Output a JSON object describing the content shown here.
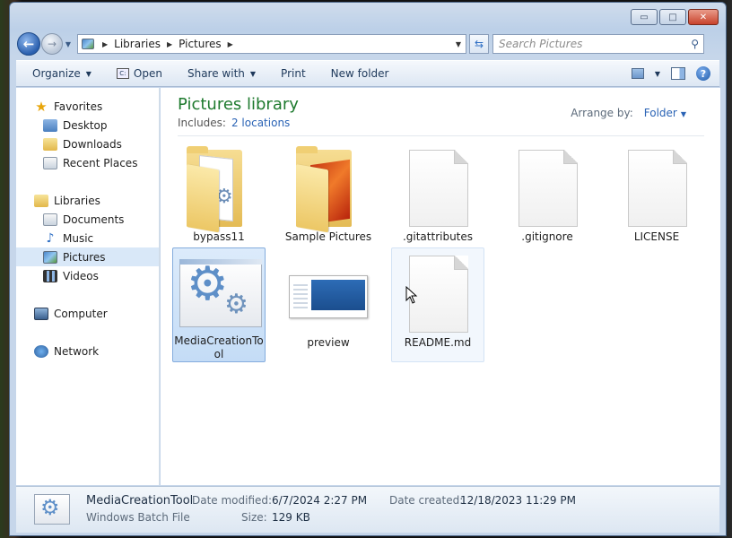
{
  "window": {
    "caption": {
      "minimize": "▭",
      "maximize": "□",
      "close": "✕"
    }
  },
  "nav": {
    "back_glyph": "←",
    "forward_glyph": "→",
    "breadcrumb": [
      "Libraries",
      "Pictures"
    ],
    "search_placeholder": "Search Pictures"
  },
  "toolbar": {
    "organize": "Organize",
    "open": "Open",
    "share_with": "Share with",
    "print": "Print",
    "new_folder": "New folder",
    "help": "?"
  },
  "sidebar": {
    "favorites": {
      "label": "Favorites",
      "items": [
        "Desktop",
        "Downloads",
        "Recent Places"
      ]
    },
    "libraries": {
      "label": "Libraries",
      "items": [
        "Documents",
        "Music",
        "Pictures",
        "Videos"
      ]
    },
    "computer": "Computer",
    "network": "Network",
    "selected": "Pictures"
  },
  "library": {
    "title": "Pictures library",
    "includes_label": "Includes:",
    "includes_link": "2 locations",
    "arrange_label": "Arrange by:",
    "arrange_value": "Folder"
  },
  "files": [
    {
      "name": "bypass11",
      "kind": "folder-docs"
    },
    {
      "name": "Sample Pictures",
      "kind": "folder-photo"
    },
    {
      "name": ".gitattributes",
      "kind": "file"
    },
    {
      "name": ".gitignore",
      "kind": "file"
    },
    {
      "name": "LICENSE",
      "kind": "file"
    },
    {
      "name": "MediaCreationTool",
      "kind": "batch",
      "selected": true
    },
    {
      "name": "preview",
      "kind": "image"
    },
    {
      "name": "README.md",
      "kind": "file",
      "hover": true
    }
  ],
  "details": {
    "name": "MediaCreationTool",
    "type": "Windows Batch File",
    "modified_label": "Date modified:",
    "modified_value": "6/7/2024 2:27 PM",
    "size_label": "Size:",
    "size_value": "129 KB",
    "created_label": "Date created:",
    "created_value": "12/18/2023 11:29 PM"
  }
}
